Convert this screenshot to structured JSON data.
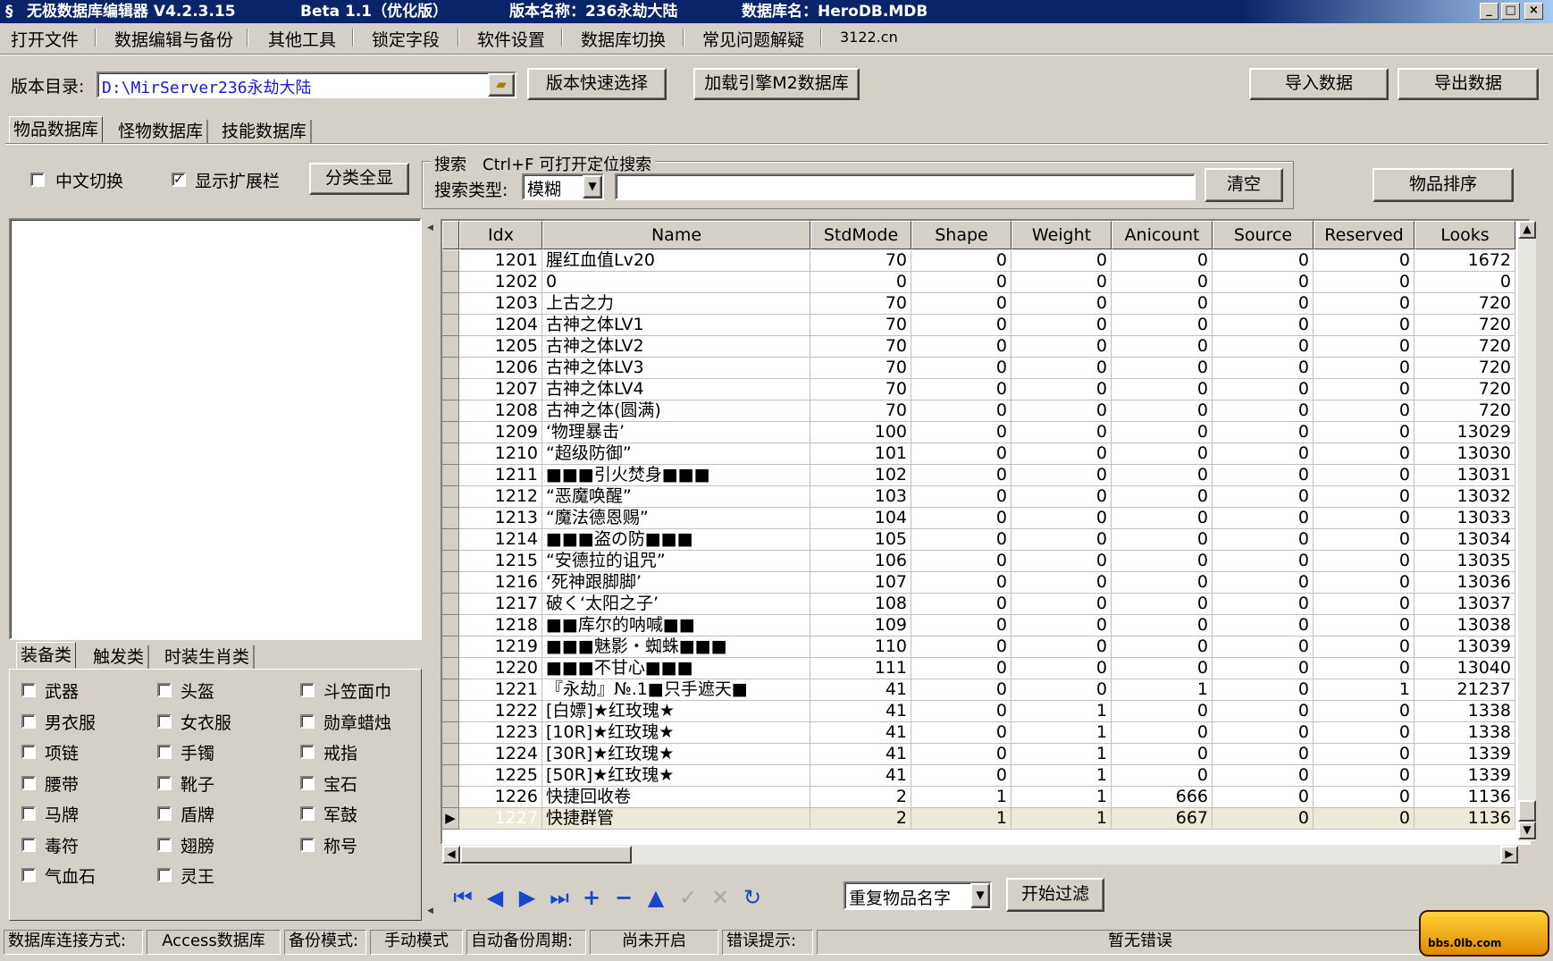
{
  "window": {
    "app_title": "无极数据库编辑器 V4.2.3.15",
    "beta": "Beta 1.1（优化版）",
    "version_name": "版本名称：236永劫大陆",
    "db_name": "数据库名：HeroDB.MDB",
    "min": "_",
    "max": "□",
    "close": "×"
  },
  "menu": [
    "打开文件",
    "数据编辑与备份",
    "其他工具",
    "锁定字段",
    "软件设置",
    "数据库切换",
    "常见问题解疑",
    "3122.cn"
  ],
  "toolbar": {
    "dir_label": "版本目录:",
    "dir_value": "D:\\MirServer236永劫大陆",
    "quick_select": "版本快速选择",
    "load_engine": "加载引擎M2数据库",
    "import": "导入数据",
    "export": "导出数据"
  },
  "db_tabs": [
    "物品数据库",
    "怪物数据库",
    "技能数据库"
  ],
  "left_panel": {
    "chinese_toggle": "中文切换",
    "show_ext": "显示扩展栏",
    "show_all": "分类全显",
    "category_tabs": [
      "装备类",
      "触发类",
      "时装生肖类"
    ],
    "categories": [
      [
        "武器",
        "头盔",
        "斗笠面巾"
      ],
      [
        "男衣服",
        "女衣服",
        "勋章蜡烛"
      ],
      [
        "项链",
        "手镯",
        "戒指"
      ],
      [
        "腰带",
        "靴子",
        "宝石"
      ],
      [
        "马牌",
        "盾牌",
        "军鼓"
      ],
      [
        "毒符",
        "翅膀",
        "称号"
      ],
      [
        "气血石",
        "灵王",
        ""
      ]
    ]
  },
  "search": {
    "group_label": "搜索　Ctrl+F 可打开定位搜索",
    "type_label": "搜索类型:",
    "type_value": "模糊",
    "input_value": "",
    "clear": "清空",
    "sort": "物品排序"
  },
  "grid": {
    "columns": [
      "Idx",
      "Name",
      "StdMode",
      "Shape",
      "Weight",
      "Anicount",
      "Source",
      "Reserved",
      "Looks"
    ],
    "rows": [
      [
        "1201",
        "腥红血值Lv20",
        "70",
        "0",
        "0",
        "0",
        "0",
        "0",
        "1672"
      ],
      [
        "1202",
        "0",
        "0",
        "0",
        "0",
        "0",
        "0",
        "0",
        "0"
      ],
      [
        "1203",
        "上古之力",
        "70",
        "0",
        "0",
        "0",
        "0",
        "0",
        "720"
      ],
      [
        "1204",
        "古神之体LV1",
        "70",
        "0",
        "0",
        "0",
        "0",
        "0",
        "720"
      ],
      [
        "1205",
        "古神之体LV2",
        "70",
        "0",
        "0",
        "0",
        "0",
        "0",
        "720"
      ],
      [
        "1206",
        "古神之体LV3",
        "70",
        "0",
        "0",
        "0",
        "0",
        "0",
        "720"
      ],
      [
        "1207",
        "古神之体LV4",
        "70",
        "0",
        "0",
        "0",
        "0",
        "0",
        "720"
      ],
      [
        "1208",
        "古神之体(圆满)",
        "70",
        "0",
        "0",
        "0",
        "0",
        "0",
        "720"
      ],
      [
        "1209",
        "‘物理暴击’",
        "100",
        "0",
        "0",
        "0",
        "0",
        "0",
        "13029"
      ],
      [
        "1210",
        "“超级防御”",
        "101",
        "0",
        "0",
        "0",
        "0",
        "0",
        "13030"
      ],
      [
        "1211",
        "■■■引火焚身■■■",
        "102",
        "0",
        "0",
        "0",
        "0",
        "0",
        "13031"
      ],
      [
        "1212",
        "“恶魔唤醒”",
        "103",
        "0",
        "0",
        "0",
        "0",
        "0",
        "13032"
      ],
      [
        "1213",
        "“魔法德恩赐”",
        "104",
        "0",
        "0",
        "0",
        "0",
        "0",
        "13033"
      ],
      [
        "1214",
        "■■■盗の防■■■",
        "105",
        "0",
        "0",
        "0",
        "0",
        "0",
        "13034"
      ],
      [
        "1215",
        "“安德拉的诅咒”",
        "106",
        "0",
        "0",
        "0",
        "0",
        "0",
        "13035"
      ],
      [
        "1216",
        "‘死神跟脚脚’",
        "107",
        "0",
        "0",
        "0",
        "0",
        "0",
        "13036"
      ],
      [
        "1217",
        "破く‘太阳之子’",
        "108",
        "0",
        "0",
        "0",
        "0",
        "0",
        "13037"
      ],
      [
        "1218",
        "■■库尔的呐喊■■",
        "109",
        "0",
        "0",
        "0",
        "0",
        "0",
        "13038"
      ],
      [
        "1219",
        "■■■魅影・蜘蛛■■■",
        "110",
        "0",
        "0",
        "0",
        "0",
        "0",
        "13039"
      ],
      [
        "1220",
        "■■■不甘心■■■",
        "111",
        "0",
        "0",
        "0",
        "0",
        "0",
        "13040"
      ],
      [
        "1221",
        "『永劫』№.1■只手遮天■",
        "41",
        "0",
        "0",
        "1",
        "0",
        "1",
        "21237"
      ],
      [
        "1222",
        "[白嫖]★红玫瑰★",
        "41",
        "0",
        "1",
        "0",
        "0",
        "0",
        "1338"
      ],
      [
        "1223",
        "[10R]★红玫瑰★",
        "41",
        "0",
        "1",
        "0",
        "0",
        "0",
        "1338"
      ],
      [
        "1224",
        "[30R]★红玫瑰★",
        "41",
        "0",
        "1",
        "0",
        "0",
        "0",
        "1339"
      ],
      [
        "1225",
        "[50R]★红玫瑰★",
        "41",
        "0",
        "1",
        "0",
        "0",
        "0",
        "1339"
      ],
      [
        "1226",
        "快捷回收卷",
        "2",
        "1",
        "1",
        "666",
        "0",
        "0",
        "1136"
      ],
      [
        "1227",
        "快捷群管",
        "2",
        "1",
        "1",
        "667",
        "0",
        "0",
        "1136"
      ]
    ],
    "selected_row_indicator": "▶"
  },
  "filter": {
    "select_value": "重复物品名字",
    "start": "开始过滤"
  },
  "nav_icons": [
    "first-icon",
    "prior-icon",
    "next-icon",
    "last-icon",
    "insert-icon",
    "delete-icon",
    "edit-icon",
    "post-icon",
    "cancel-icon",
    "refresh-icon"
  ],
  "statusbar": {
    "conn_label": "数据库连接方式:",
    "conn_value": "Access数据库",
    "backup_label": "备份模式:",
    "backup_value": "手动模式",
    "auto_label": "自动备份周期:",
    "auto_value": "尚未开启",
    "error_label": "错误提示:",
    "error_value": "暂无错误"
  },
  "watermark": "bbs.0lb.com",
  "colors": {
    "title_bar": "#0a246a",
    "selection": "#0a246a",
    "path_text": "#1a1ad0",
    "nav_blue": "#1848c8"
  }
}
